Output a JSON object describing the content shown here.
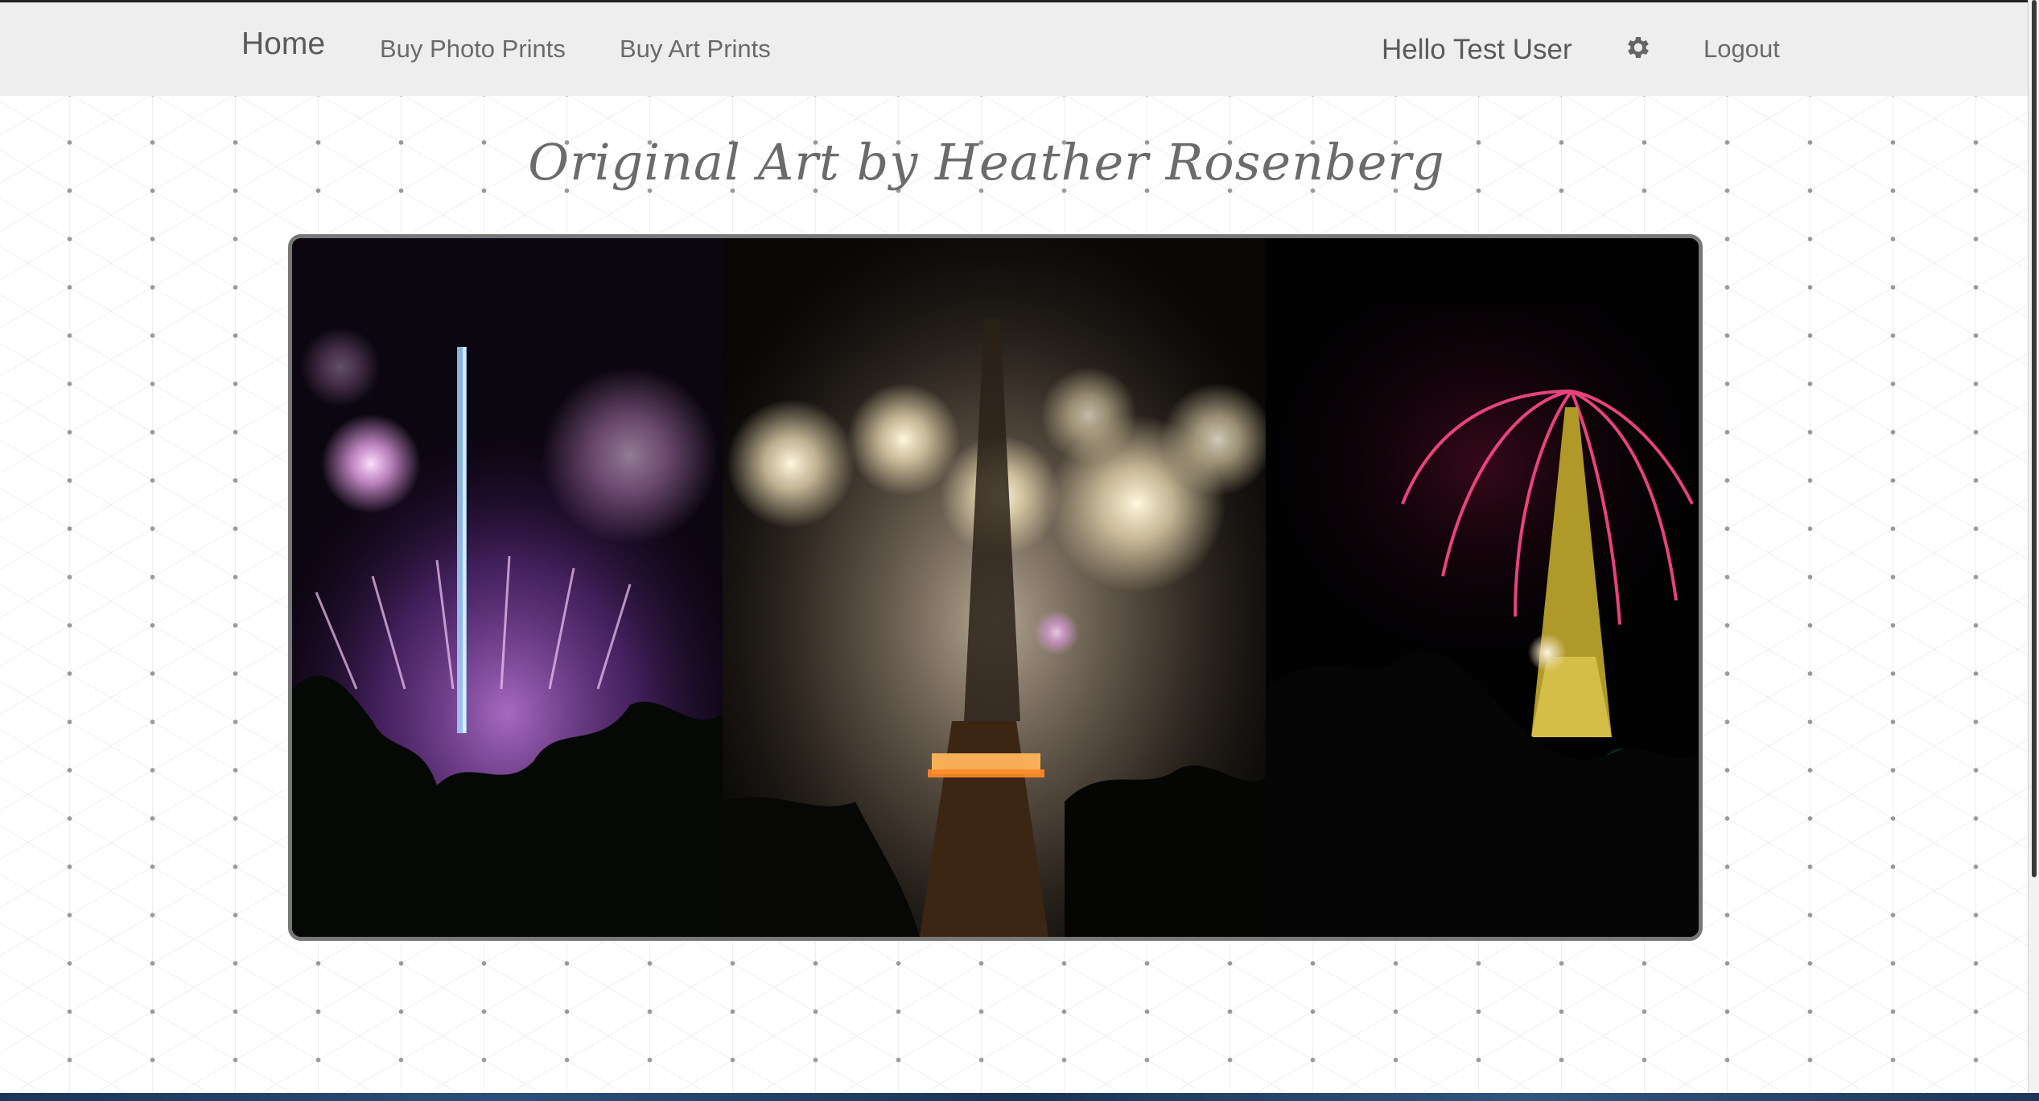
{
  "navbar": {
    "brand": "Home",
    "links": [
      "Buy Photo Prints",
      "Buy Art Prints"
    ],
    "user_greeting": "Hello Test User",
    "settings_icon": "gear-icon",
    "logout": "Logout"
  },
  "page": {
    "title": "Original Art by Heather Rosenberg"
  },
  "hero": {
    "panels": [
      "purple-fireworks-eiffel-tower",
      "white-fireworks-eiffel-tower",
      "red-fireworks-eiffel-tower"
    ]
  },
  "colors": {
    "navbar_bg": "#eeeeee",
    "text": "#555555",
    "frame_border": "#777777"
  }
}
